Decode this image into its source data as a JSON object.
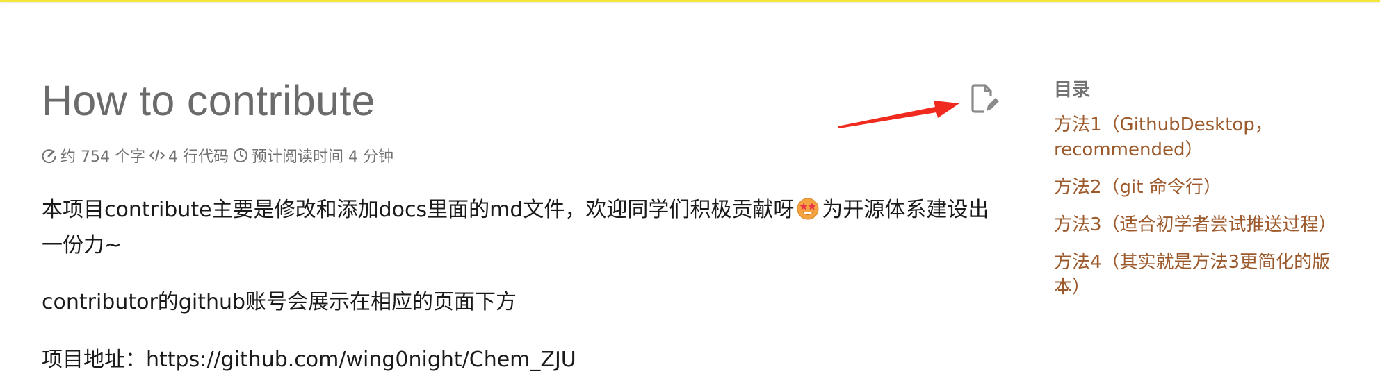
{
  "header": {
    "accent_color": "#f5e63a"
  },
  "article": {
    "title": "How to contribute",
    "edit_icon": "edit-document-icon",
    "meta": {
      "word_count": "约 754 个字",
      "code_lines": "4 行代码",
      "reading_time": "预计阅读时间 4 分钟"
    },
    "paragraphs": {
      "p1_before_emoji": "本项目contribute主要是修改和添加docs里面的md文件，欢迎同学们积极贡献呀",
      "p1_after_emoji": "为开源体系建设出一份力~",
      "p2": "contributor的github账号会展示在相应的页面下方",
      "p3": "项目地址：https://github.com/wing0night/Chem_ZJU"
    }
  },
  "toc": {
    "title": "目录",
    "items": [
      "方法1（GithubDesktop，recommended）",
      "方法2（git 命令行）",
      "方法3（适合初学者尝试推送过程）",
      "方法4（其实就是方法3更简化的版本）"
    ],
    "link_color": "#9c5a2c"
  },
  "annotation": {
    "arrow_color": "#f02a1e"
  }
}
